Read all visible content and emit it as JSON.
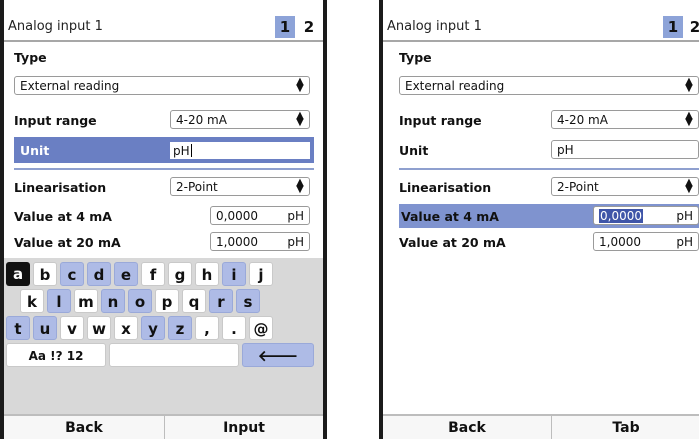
{
  "left": {
    "title": "Analog input 1",
    "tabs": [
      "1",
      "2"
    ],
    "type_label": "Type",
    "type_value": "External reading",
    "input_range_label": "Input range",
    "input_range_value": "4-20 mA",
    "unit_label": "Unit",
    "unit_value": "pH",
    "linearisation_label": "Linearisation",
    "linearisation_value": "2-Point",
    "value4_label": "Value at 4 mA",
    "value4_value": "0,0000",
    "value4_unit": "pH",
    "value20_label": "Value at 20 mA",
    "value20_value": "1,0000",
    "value20_unit": "pH",
    "keyboard": {
      "row1": [
        "a",
        "b",
        "c",
        "d",
        "e",
        "f",
        "g",
        "h",
        "i",
        "j"
      ],
      "row2": [
        "k",
        "l",
        "m",
        "n",
        "o",
        "p",
        "q",
        "r",
        "s"
      ],
      "row3": [
        "t",
        "u",
        "v",
        "w",
        "x",
        "y",
        "z",
        ",",
        ".",
        "@"
      ],
      "mode_key": "Aa !? 12",
      "backspace_key": "🡐"
    },
    "softkeys": [
      "Back",
      "Input"
    ]
  },
  "right": {
    "title": "Analog input 1",
    "tabs": [
      "1",
      "2"
    ],
    "type_label": "Type",
    "type_value": "External reading",
    "input_range_label": "Input range",
    "input_range_value": "4-20 mA",
    "unit_label": "Unit",
    "unit_value": "pH",
    "linearisation_label": "Linearisation",
    "linearisation_value": "2-Point",
    "value4_label": "Value at 4 mA",
    "value4_value": "0,0000",
    "value4_unit": "pH",
    "value20_label": "Value at 20 mA",
    "value20_value": "1,0000",
    "value20_unit": "pH",
    "softkeys": [
      "Back",
      "Tab"
    ]
  },
  "icons": {
    "dropdown": "up-down-arrows-icon",
    "backspace": "backspace-arrow-icon"
  },
  "colors": {
    "accent": "#6a7fc3",
    "tab_active": "#8da3d8",
    "key_blue": "#aebbe6"
  }
}
